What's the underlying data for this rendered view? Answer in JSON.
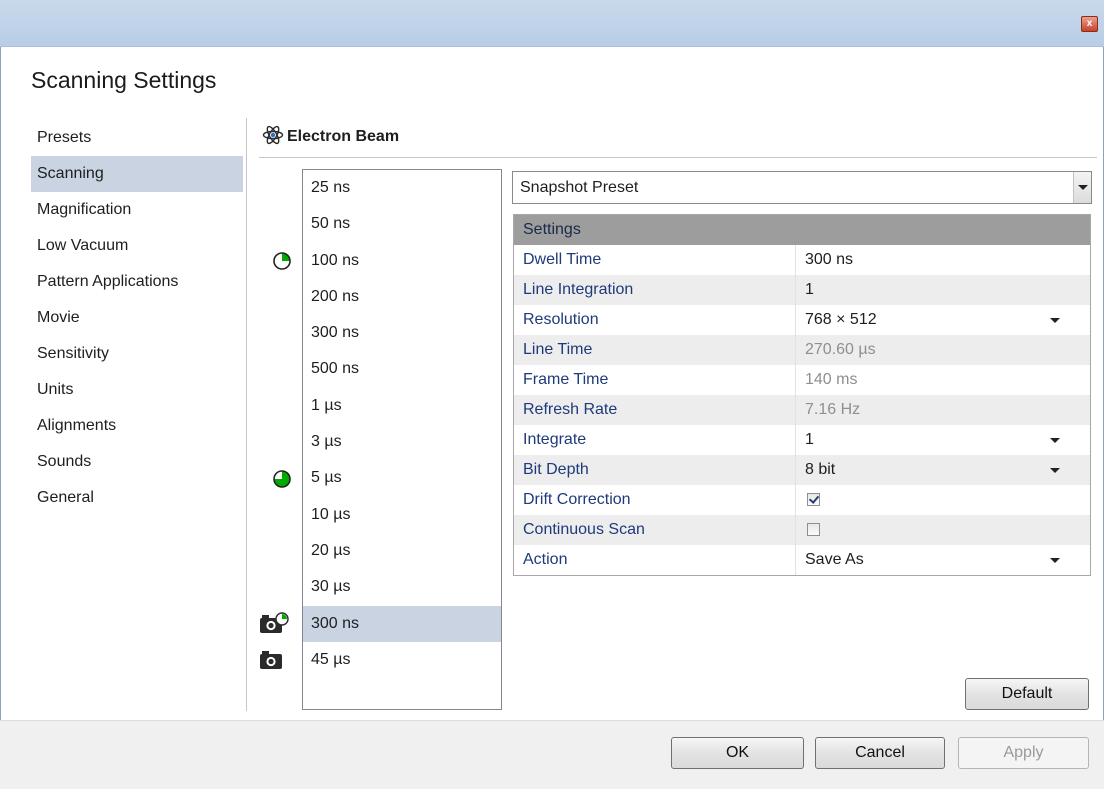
{
  "window": {
    "close_glyph": "x",
    "title": "Scanning Settings"
  },
  "sidebar": {
    "items": [
      {
        "label": "Presets"
      },
      {
        "label": "Scanning",
        "selected": true
      },
      {
        "label": "Magnification"
      },
      {
        "label": "Low Vacuum"
      },
      {
        "label": "Pattern Applications"
      },
      {
        "label": "Movie"
      },
      {
        "label": "Sensitivity"
      },
      {
        "label": "Units"
      },
      {
        "label": "Alignments"
      },
      {
        "label": "Sounds"
      },
      {
        "label": "General"
      }
    ]
  },
  "beam": {
    "label": "Electron Beam",
    "icon": "atom-icon"
  },
  "dwell_list": {
    "items": [
      "25 ns",
      "50 ns",
      "100 ns",
      "200 ns",
      "300 ns",
      "500 ns",
      "1 µs",
      "3 µs",
      "5 µs",
      "10 µs",
      "20 µs",
      "30 µs",
      "300 ns",
      "45 µs"
    ],
    "selected_index": 12,
    "markers": [
      {
        "row_index": 2,
        "icon": "pie-quarter-icon",
        "fill": 0.25,
        "color": "#00aa00"
      },
      {
        "row_index": 8,
        "icon": "pie-three-quarter-icon",
        "fill": 0.75,
        "color": "#00aa00"
      },
      {
        "row_index": 12,
        "icon": "camera-clock-icon"
      },
      {
        "row_index": 13,
        "icon": "camera-icon"
      }
    ]
  },
  "preset": {
    "value": "Snapshot Preset"
  },
  "settings": {
    "header": "Settings",
    "rows": [
      {
        "key": "Dwell Time",
        "value": "300 ns"
      },
      {
        "key": "Line Integration",
        "value": "1"
      },
      {
        "key": "Resolution",
        "value": "768 × 512",
        "dropdown": true
      },
      {
        "key": "Line Time",
        "value": "270.60 µs",
        "disabled": true
      },
      {
        "key": "Frame Time",
        "value": "140 ms",
        "disabled": true
      },
      {
        "key": "Refresh Rate",
        "value": "7.16 Hz",
        "disabled": true
      },
      {
        "key": "Integrate",
        "value": "1",
        "dropdown": true
      },
      {
        "key": "Bit Depth",
        "value": "8 bit",
        "dropdown": true
      },
      {
        "key": "Drift Correction",
        "checkbox": true,
        "checked": true
      },
      {
        "key": "Continuous Scan",
        "checkbox": true,
        "checked": false
      },
      {
        "key": "Action",
        "value": "Save As",
        "dropdown": true
      }
    ]
  },
  "buttons": {
    "default": "Default",
    "ok": "OK",
    "cancel": "Cancel",
    "apply": "Apply"
  },
  "colors": {
    "selection": "#c9d3e2",
    "titlebar": "#c9d9ec",
    "grid_header": "#9d9d9d",
    "key_text": "#1f3a7a",
    "pie_green": "#00aa00"
  }
}
